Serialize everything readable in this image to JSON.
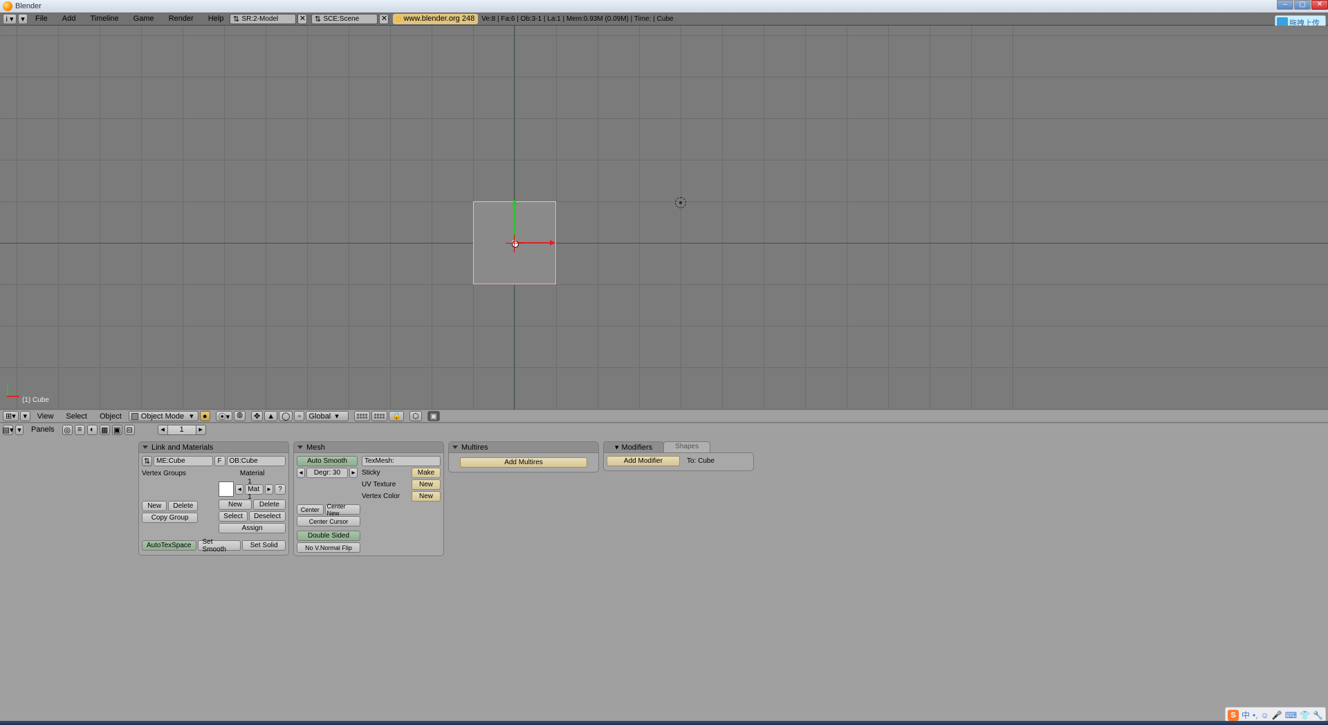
{
  "window": {
    "app_name": "Blender"
  },
  "header": {
    "menu": [
      "File",
      "Add",
      "Timeline",
      "Game",
      "Render",
      "Help"
    ],
    "screen_field": "SR:2-Model",
    "scene_field": "SCE:Scene",
    "url_text": "www.blender.org 248",
    "stats": "Ve:8 | Fa:6 | Ob:3-1 | La:1   | Mem:0.93M (0.09M)  | Time:  | Cube",
    "overlay_badge": "拖拽上传"
  },
  "viewport": {
    "object_label": "(1) Cube",
    "toolbar": {
      "menus": [
        "View",
        "Select",
        "Object"
      ],
      "mode": "Object Mode",
      "orient": "Global"
    }
  },
  "panels_bar": {
    "title": "Panels",
    "frame": "1"
  },
  "link_mat": {
    "title": "Link and Materials",
    "me_field": "ME:Cube",
    "f": "F",
    "ob_field": "OB:Cube",
    "vgroups": "Vertex Groups",
    "material": "Material",
    "mat_nav": "1 Mat 1",
    "q": "?",
    "new": "New",
    "delete": "Delete",
    "copy_group": "Copy Group",
    "select": "Select",
    "deselect": "Deselect",
    "assign": "Assign",
    "autotex": "AutoTexSpace",
    "set_smooth": "Set Smooth",
    "set_solid": "Set Solid"
  },
  "mesh": {
    "title": "Mesh",
    "auto_smooth": "Auto Smooth",
    "degr": "Degr: 30",
    "texmesh": "TexMesh:",
    "sticky": "Sticky",
    "uv": "UV Texture",
    "vcol": "Vertex Color",
    "make": "Make",
    "new": "New",
    "center": "Center",
    "center_new": "Center New",
    "center_cursor": "Center Cursor",
    "double_sided": "Double Sided",
    "no_vnorm": "No V.Normal Flip"
  },
  "multires": {
    "title": "Multires",
    "add": "Add Multires"
  },
  "modifiers": {
    "title": "Modifiers",
    "shapes_tab": "Shapes",
    "add": "Add Modifier",
    "to": "To: Cube"
  }
}
